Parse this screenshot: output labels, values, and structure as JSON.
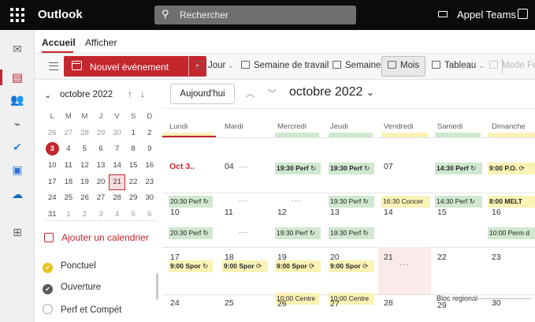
{
  "topbar": {
    "app_name": "Outlook",
    "search_placeholder": "Rechercher",
    "teams_label": "Appel Teams"
  },
  "tabs": [
    {
      "label": "Accueil",
      "selected": true
    },
    {
      "label": "Afficher",
      "selected": false
    }
  ],
  "ribbon": {
    "new_event": "Nouvel événement",
    "views": [
      {
        "label": "Jour",
        "chevron": true,
        "icon": "day-view-icon"
      },
      {
        "label": "Semaine de travail",
        "icon": "work-week-icon"
      },
      {
        "label": "Semaine",
        "icon": "week-view-icon"
      },
      {
        "label": "Mois",
        "icon": "month-view-icon",
        "selected": true
      },
      {
        "label": "Tableau",
        "chevron": true,
        "icon": "board-icon"
      },
      {
        "label": "Mode Fra",
        "icon": "split-view-icon",
        "disabled": true
      }
    ]
  },
  "mini_calendar": {
    "title": "octobre 2022",
    "day_headers": [
      "L",
      "M",
      "M",
      "J",
      "V",
      "S",
      "D"
    ],
    "weeks": [
      [
        "26",
        "27",
        "28",
        "29",
        "30",
        "1",
        "2"
      ],
      [
        "3",
        "4",
        "5",
        "6",
        "7",
        "8",
        "9"
      ],
      [
        "10",
        "11",
        "12",
        "13",
        "14",
        "15",
        "16"
      ],
      [
        "17",
        "18",
        "19",
        "20",
        "21",
        "22",
        "23"
      ],
      [
        "24",
        "25",
        "26",
        "27",
        "28",
        "29",
        "30"
      ],
      [
        "31",
        "1",
        "2",
        "3",
        "4",
        "5",
        "6"
      ]
    ],
    "today": "3",
    "selected": "21"
  },
  "add_calendar": "Ajouter un calendrier",
  "calendars": [
    {
      "name": "Ponctuel",
      "color": "#e8c21b",
      "checked": true
    },
    {
      "name": "Ouverture",
      "color": "#5a5a5a",
      "checked": true
    },
    {
      "name": "Perf et Compét",
      "color": "#ffffff",
      "checked": false
    }
  ],
  "main": {
    "today_button": "Aujourd'hui",
    "month_title": "octobre 2022",
    "weekdays": [
      "Lundi",
      "Mardi",
      "Mercredi",
      "Jeudi",
      "Vendredi",
      "Samedi",
      "Dimanche"
    ],
    "week1": {
      "dates": [
        "Oct 3..",
        "04",
        "05",
        "06",
        "07",
        "08",
        "09"
      ],
      "events": [
        {
          "col": 2,
          "text": "19:30 Perf",
          "icon": "↻",
          "color": "green"
        },
        {
          "col": 3,
          "text": "19:30 Perf",
          "icon": "↻",
          "color": "green"
        },
        {
          "col": 5,
          "text": "14:30 Perf",
          "icon": "↻",
          "color": "green"
        },
        {
          "col": 6,
          "text": "9:00 P.O.",
          "icon": "⟳",
          "color": "yellow"
        }
      ]
    },
    "week2": {
      "dates": [
        "10",
        "11",
        "12",
        "13",
        "14",
        "15",
        "16"
      ],
      "events_top": [
        {
          "col": 0,
          "text": "20:30 Perf",
          "icon": "↻",
          "color": "green"
        },
        {
          "col": 3,
          "text": "19:30 Perf",
          "icon": "↻",
          "color": "green"
        },
        {
          "col": 4,
          "text": "16:30 Concer",
          "color": "yellow"
        },
        {
          "col": 5,
          "text": "14:30 Perf",
          "icon": "↻",
          "color": "green"
        },
        {
          "col": 6,
          "text": "8:00 MELT",
          "color": "yellow",
          "bold": true
        }
      ],
      "events_bottom": [
        {
          "col": 0,
          "text": "20:30 Perf",
          "icon": "↻",
          "color": "green"
        },
        {
          "col": 2,
          "text": "19:30 Perf",
          "icon": "↻",
          "color": "green"
        },
        {
          "col": 3,
          "text": "19:30 Perf",
          "icon": "↻",
          "color": "green"
        },
        {
          "col": 6,
          "text": "10:00 Perm d",
          "color": "green"
        }
      ]
    },
    "week3": {
      "dates": [
        "17",
        "18",
        "19",
        "20",
        "21",
        "22",
        "23"
      ],
      "events": [
        {
          "col": 0,
          "text": "9:00 Spor",
          "icon": "↻",
          "color": "yellow"
        },
        {
          "col": 1,
          "text": "9:00 Spor",
          "icon": "⟳",
          "color": "yellow"
        },
        {
          "col": 2,
          "text": "9:00 Spor",
          "icon": "⟳",
          "color": "yellow"
        },
        {
          "col": 3,
          "text": "9:00 Spor",
          "icon": "⟳",
          "color": "yellow"
        }
      ]
    },
    "week4": {
      "dates": [
        "24",
        "25",
        "26",
        "27",
        "28",
        "29",
        "30"
      ],
      "events": [
        {
          "col": 2,
          "text": "10:00 Centre",
          "color": "yellow"
        },
        {
          "col": 3,
          "text": "10:00 Centre",
          "color": "yellow"
        }
      ],
      "bloc": "Bloc regional"
    },
    "more_label": "···"
  }
}
